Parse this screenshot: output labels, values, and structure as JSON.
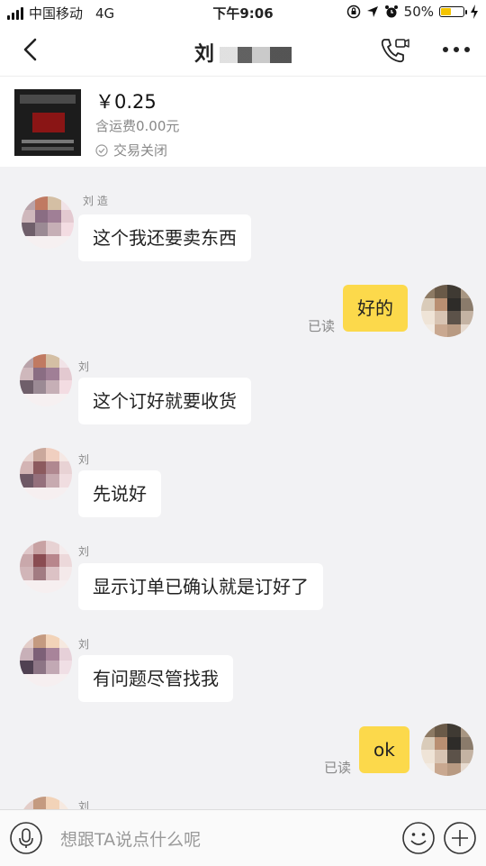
{
  "status_bar": {
    "carrier": "中国移动",
    "network": "4G",
    "time": "下午9:06",
    "battery": "50%",
    "battery_level": 0.5
  },
  "nav": {
    "title": "刘",
    "back_icon": "chevron-left-icon",
    "call_icon": "phone-video-icon",
    "more_icon": "more-dots-icon"
  },
  "product": {
    "price": "￥0.25",
    "shipping": "含运费0.00元",
    "status": "交易关闭"
  },
  "messages": [
    {
      "from": "other",
      "sender": "刘 造",
      "text": "这个我还要卖东西"
    },
    {
      "from": "me",
      "text": "好的",
      "read": "已读"
    },
    {
      "from": "other",
      "sender": "刘",
      "text": "这个订好就要收货"
    },
    {
      "from": "other",
      "sender": "刘",
      "text": "先说好"
    },
    {
      "from": "other",
      "sender": "刘",
      "text": "显示订单已确认就是订好了"
    },
    {
      "from": "other",
      "sender": "刘",
      "text": "有问题尽管找我"
    },
    {
      "from": "me",
      "text": "ok",
      "read": "已读"
    },
    {
      "from": "other",
      "sender": "刘"
    }
  ],
  "input": {
    "placeholder": "想跟TA说点什么呢",
    "voice_icon": "microphone-icon",
    "emoji_icon": "smile-icon",
    "add_icon": "plus-icon"
  },
  "colors": {
    "my_bubble": "#fcd94b",
    "other_bubble": "#ffffff",
    "background": "#f2f2f4"
  }
}
